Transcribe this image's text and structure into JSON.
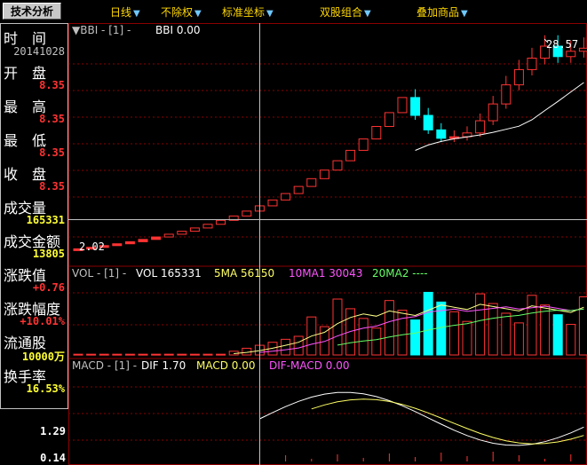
{
  "toolbar": {
    "tab_label": "技术分析",
    "menus": [
      "日线",
      "不除权",
      "标准坐标",
      "双股组合",
      "叠加商品"
    ]
  },
  "info": {
    "time_label": "时　间",
    "date": "20141028",
    "open_label": "开　盘",
    "open": "8.35",
    "high_label": "最　高",
    "high": "8.35",
    "low_label": "最　低",
    "low": "8.35",
    "close_label": "收　盘",
    "close": "8.35",
    "volume_label": "成交量",
    "volume": "165331",
    "amount_label": "成交金额",
    "amount": "13805",
    "change_label": "涨跌值",
    "change": "+0.76",
    "change_pct_label": "涨跌幅度",
    "change_pct": "+10.01%",
    "float_label": "流通股",
    "float": "10000万",
    "turnover_label": "换手率",
    "turnover": "16.53%"
  },
  "panels": {
    "main": {
      "name": "▼BBI",
      "param": "[1]",
      "label": "BBI 0.00"
    },
    "vol": {
      "name": "VOL",
      "param": "[1]",
      "label": "VOL 165331",
      "ma5": "5MA 56150",
      "ma10": "10MA1 30043",
      "ma20": "20MA2 ----"
    },
    "macd": {
      "name": "MACD",
      "param": "[1]",
      "dif": "DIF 1.70",
      "macd": "MACD 0.00",
      "diffmacd": "DIF-MACD 0.00"
    }
  },
  "axis": {
    "a1": "1.29",
    "a2": "0.14"
  },
  "chart_data": {
    "type": "candlestick",
    "price_annotations": {
      "high": "28.57",
      "low": "2.02"
    },
    "candles_close": [
      2.02,
      2.22,
      2.44,
      2.68,
      2.95,
      3.25,
      3.57,
      3.93,
      4.32,
      4.75,
      5.23,
      5.75,
      6.32,
      6.96,
      7.65,
      8.42,
      9.26,
      10.19,
      11.21,
      12.33,
      13.56,
      14.92,
      16.41,
      18.05,
      19.86,
      21.84,
      19.5,
      17.6,
      16.5,
      16.7,
      17.2,
      18.8,
      21.0,
      23.5,
      25.5,
      27.0,
      28.57,
      27.2,
      27.9,
      28.3
    ]
  },
  "colors": {
    "up": "#ff3333",
    "down": "#00ffff",
    "bbi": "#ffffff",
    "ma5": "#ffffff",
    "ma10": "#ff55ff",
    "ma20": "#66ff66"
  }
}
